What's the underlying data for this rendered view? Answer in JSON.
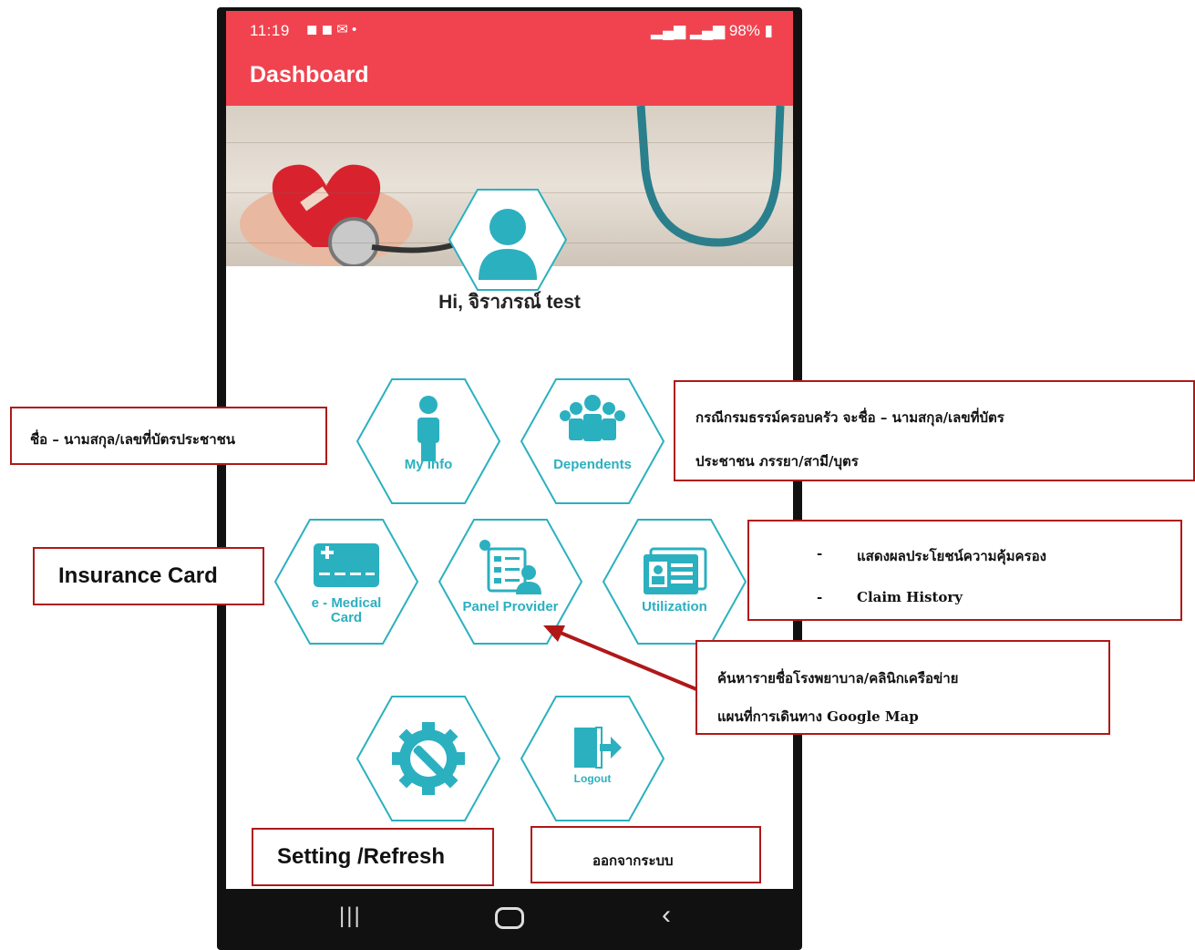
{
  "status_bar": {
    "time": "11:19",
    "battery": "98%"
  },
  "app_bar": {
    "title": "Dashboard"
  },
  "greeting": "Hi, จิราภรณ์ test",
  "menu": {
    "my_info": "My Info",
    "dependents": "Dependents",
    "e_medical_card_line1": "e - Medical",
    "e_medical_card_line2": "Card",
    "panel_provider": "Panel Provider",
    "utilization": "Utilization",
    "logout": "Logout"
  },
  "annotations": {
    "name_id": "ชื่อ – นามสกุล/เลขที่บัตรประชาชน",
    "family_line1": "กรณีกรมธรรม์ครอบครัว จะชื่อ – นามสกุล/เลขที่บัตร",
    "family_line2": "ประชาชน ภรรยา/สามี/บุตร",
    "insurance_card": "Insurance Card",
    "benefits": "แสดงผลประโยชน์ความคุ้มครอง",
    "claim_history": "Claim History",
    "search_line1": "ค้นหารายชื่อโรงพยาบาล/คลินิกเครือข่าย",
    "search_line2": "แผนที่การเดินทาง Google Map",
    "setting_refresh": "Setting /Refresh",
    "logout_th": "ออกจากระบบ"
  },
  "colors": {
    "app_red": "#f0434f",
    "teal": "#2bb0c0",
    "annotation_border": "#b01818"
  }
}
